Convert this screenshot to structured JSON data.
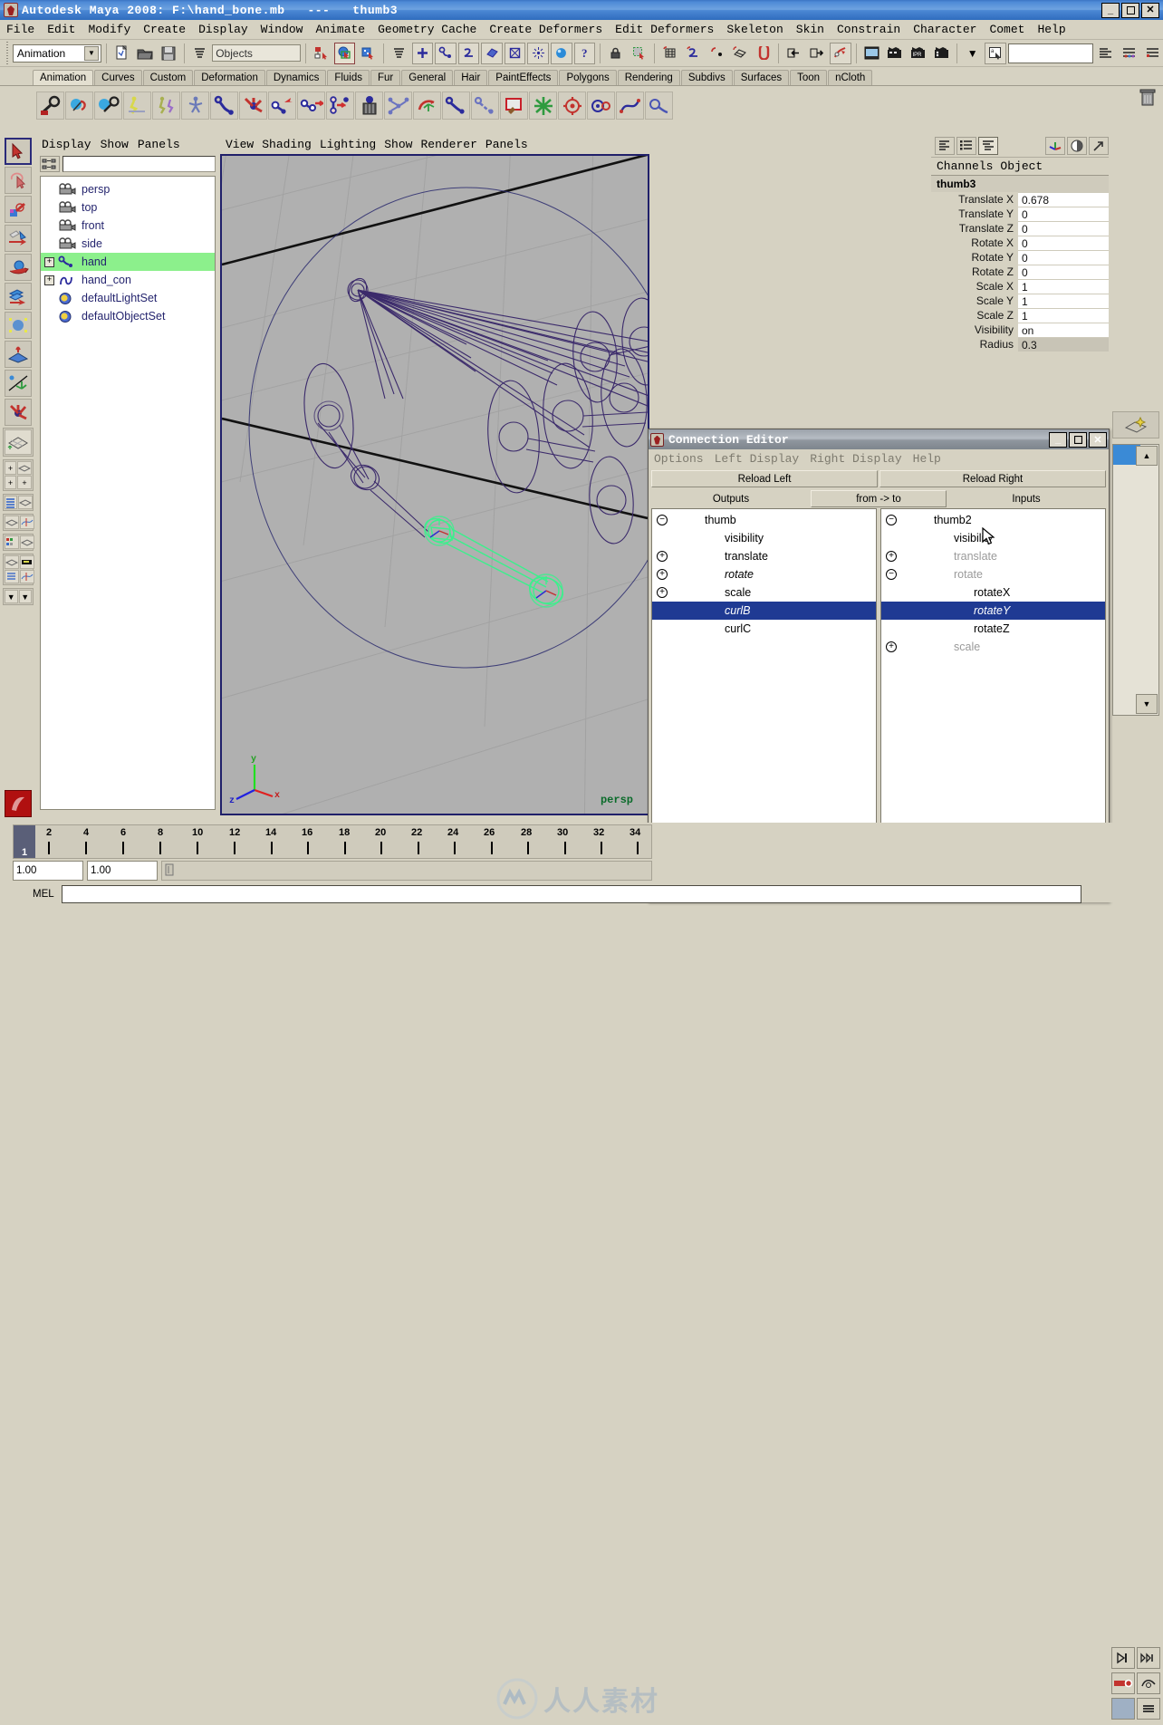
{
  "window": {
    "title": "Autodesk Maya 2008: F:\\hand_bone.mb   ---   thumb3",
    "minimize": "_",
    "maximize": "❐",
    "close": "✕",
    "app_icon": "maya-icon"
  },
  "menubar": {
    "items": [
      "File",
      "Edit",
      "Modify",
      "Create",
      "Display",
      "Window",
      "Animate",
      "Geometry Cache",
      "Create Deformers",
      "Edit Deformers",
      "Skeleton",
      "Skin",
      "Constrain",
      "Character",
      "Comet",
      "Help"
    ]
  },
  "statusline": {
    "menuset_value": "Animation",
    "object_field_value": "Objects",
    "numeric_field_value": "",
    "icons": [
      "new-scene-icon",
      "open-scene-icon",
      "save-scene-icon",
      "selection-mask-icon",
      "select-by-hierarchy-icon",
      "select-by-object-icon",
      "select-by-component-icon",
      "selection-mask-menu-icon",
      "handle-icon",
      "curve-icon",
      "surface-icon",
      "poly-icon",
      "deformer-icon",
      "dynamic-icon",
      "render-icon",
      "misc-icon",
      "lock-icon",
      "highlight-icon",
      "snap-to-grid-icon",
      "snap-to-curve-icon",
      "snap-to-point-icon",
      "snap-to-view-plane-icon",
      "magnet-icon",
      "input-connection-icon",
      "output-connection-icon",
      "construction-history-icon",
      "render-view-icon",
      "render-current-frame-icon",
      "ipr-render-icon",
      "render-settings-icon",
      "menu-arrow-icon",
      "script-editor-icon",
      "sidebar-attribute-editor-icon",
      "sidebar-tool-settings-icon",
      "sidebar-channel-box-icon"
    ]
  },
  "shelf": {
    "tabs": [
      "Animation",
      "Curves",
      "Custom",
      "Deformation",
      "Dynamics",
      "Fluids",
      "Fur",
      "General",
      "Hair",
      "PaintEffects",
      "Polygons",
      "Rendering",
      "Subdivs",
      "Surfaces",
      "Toon",
      "nCloth"
    ],
    "active_tab": "Animation",
    "buttons": [
      "set-key-icon",
      "set-breakdown-key-icon",
      "set-driven-key-icon",
      "ik-handle-tool-icon",
      "ik-spline-handle-icon",
      "full-body-ik-icon",
      "joint-tool-icon",
      "ik-handle-icon",
      "insert-joint-icon",
      "reroot-skeleton-icon",
      "remove-joint-icon",
      "delete-joint-icon",
      "mirror-joint-icon",
      "orient-joint-icon",
      "bind-skin-icon",
      "detach-skin-icon",
      "paint-weights-icon",
      "cluster-icon",
      "lattice-icon",
      "blend-shape-icon",
      "wire-tool-icon",
      "sculpt-icon"
    ],
    "trash_icon": "trash-icon"
  },
  "left_toolbox": {
    "tools": [
      "select-tool-icon",
      "lasso-tool-icon",
      "paint-select-tool-icon",
      "move-tool-icon",
      "rotate-tool-icon",
      "scale-tool-icon",
      "universal-manipulator-icon",
      "soft-modification-icon",
      "show-manipulator-icon",
      "last-tool-icon"
    ],
    "active_tool": "select-tool-icon",
    "layouts": [
      "single-perspective-layout-icon",
      "four-view-layout-icon",
      "outliner-persp-layout-icon",
      "persp-graph-layout-icon",
      "hypershade-persp-layout-icon",
      "persp-graph-editor-layout-icon",
      "layout-dropdown-icon"
    ],
    "bottom_icon": "maya-logo-icon"
  },
  "outliner": {
    "menus": [
      "Display",
      "Show",
      "Panels"
    ],
    "search_icon": "outliner-filter-icon",
    "search_value": "",
    "items": [
      {
        "label": "persp",
        "icon": "camera-icon",
        "expand": ""
      },
      {
        "label": "top",
        "icon": "camera-icon",
        "expand": ""
      },
      {
        "label": "front",
        "icon": "camera-icon",
        "expand": ""
      },
      {
        "label": "side",
        "icon": "camera-icon",
        "expand": ""
      },
      {
        "label": "hand",
        "icon": "joint-icon",
        "expand": "+",
        "selected": true
      },
      {
        "label": "hand_con",
        "icon": "curve-icon",
        "expand": "+"
      },
      {
        "label": "defaultLightSet",
        "icon": "set-icon",
        "expand": ""
      },
      {
        "label": "defaultObjectSet",
        "icon": "set-icon",
        "expand": ""
      }
    ]
  },
  "viewport": {
    "menus": [
      "View",
      "Shading",
      "Lighting",
      "Show",
      "Renderer",
      "Panels"
    ],
    "camera_label": "persp",
    "axis_x": "x",
    "axis_y": "y",
    "axis_z": "z"
  },
  "channel_box": {
    "icons": [
      "channel-box-icon",
      "layer-editor-icon",
      "channel-and-layers-icon"
    ],
    "right_icons": [
      "attribute-editor-icon",
      "render-settings-icon",
      "expand-icon"
    ],
    "menus": [
      "Channels",
      "Object"
    ],
    "node_name": "thumb3",
    "channels": [
      {
        "label": "Translate X",
        "value": "0.678"
      },
      {
        "label": "Translate Y",
        "value": "0"
      },
      {
        "label": "Translate Z",
        "value": "0"
      },
      {
        "label": "Rotate X",
        "value": "0"
      },
      {
        "label": "Rotate Y",
        "value": "0"
      },
      {
        "label": "Rotate Z",
        "value": "0"
      },
      {
        "label": "Scale X",
        "value": "1"
      },
      {
        "label": "Scale Y",
        "value": "1"
      },
      {
        "label": "Scale Z",
        "value": "1"
      },
      {
        "label": "Visibility",
        "value": "on"
      },
      {
        "label": "Radius",
        "value": "0.3",
        "greyed": true
      }
    ]
  },
  "right_toolbar": {
    "icons": [
      "new-layer-icon",
      "layer-up-icon",
      "layer-down-icon"
    ],
    "bottom_icons": [
      "playback-end-icon",
      "playback-step-icon",
      "auto-key-icon",
      "animation-preferences-icon",
      "range-slider-icon"
    ]
  },
  "connection_editor": {
    "title": "Connection Editor",
    "icon": "maya-icon",
    "window_buttons": {
      "minimize": "_",
      "maximize": "❐",
      "close": "✕"
    },
    "menus": [
      "Options",
      "Left Display",
      "Right Display",
      "Help"
    ],
    "reload_left": "Reload Left",
    "reload_right": "Reload Right",
    "outputs_label": "Outputs",
    "direction_label": "from -> to",
    "inputs_label": "Inputs",
    "left_items": [
      {
        "label": "thumb",
        "expand": "⊖",
        "indent": 0
      },
      {
        "label": "visibility",
        "expand": "",
        "indent": 1
      },
      {
        "label": "translate",
        "expand": "⊕",
        "indent": 1
      },
      {
        "label": "rotate",
        "expand": "⊕",
        "indent": 1,
        "italic": true
      },
      {
        "label": "scale",
        "expand": "⊕",
        "indent": 1
      },
      {
        "label": "curlB",
        "expand": "",
        "indent": 1,
        "selected": true,
        "italic": true
      },
      {
        "label": "curlC",
        "expand": "",
        "indent": 1
      }
    ],
    "right_items": [
      {
        "label": "thumb2",
        "expand": "⊖",
        "indent": 0
      },
      {
        "label": "visibility",
        "expand": "",
        "indent": 1
      },
      {
        "label": "translate",
        "expand": "⊕",
        "indent": 1,
        "dim": true
      },
      {
        "label": "rotate",
        "expand": "⊖",
        "indent": 1,
        "dim": true
      },
      {
        "label": "rotateX",
        "expand": "",
        "indent": 2
      },
      {
        "label": "rotateY",
        "expand": "",
        "indent": 2,
        "selected": true,
        "italic": true
      },
      {
        "label": "rotateZ",
        "expand": "",
        "indent": 2
      },
      {
        "label": "scale",
        "expand": "⊕",
        "indent": 1,
        "dim": true
      }
    ]
  },
  "timeline": {
    "current_frame": "1",
    "ticks": [
      "2",
      "4",
      "6",
      "8",
      "10",
      "12",
      "14",
      "16",
      "18",
      "20",
      "22",
      "24",
      "26",
      "28",
      "30",
      "32",
      "34"
    ],
    "range_start": "1.00",
    "range_end": "1.00"
  },
  "command_line": {
    "label": "MEL",
    "value": ""
  },
  "watermark": {
    "text": "人人素材",
    "logo": "maya-m-logo"
  },
  "colors": {
    "title_blue": "#4e8ad6",
    "panel_bg": "#d6d2c2",
    "viewport_bg": "#b0b0b0",
    "selection_green": "#8cf08c",
    "list_selection_blue": "#1f3a93",
    "joint_purple": "#3b2a6b",
    "camera_label_green": "#0a6b2a"
  }
}
